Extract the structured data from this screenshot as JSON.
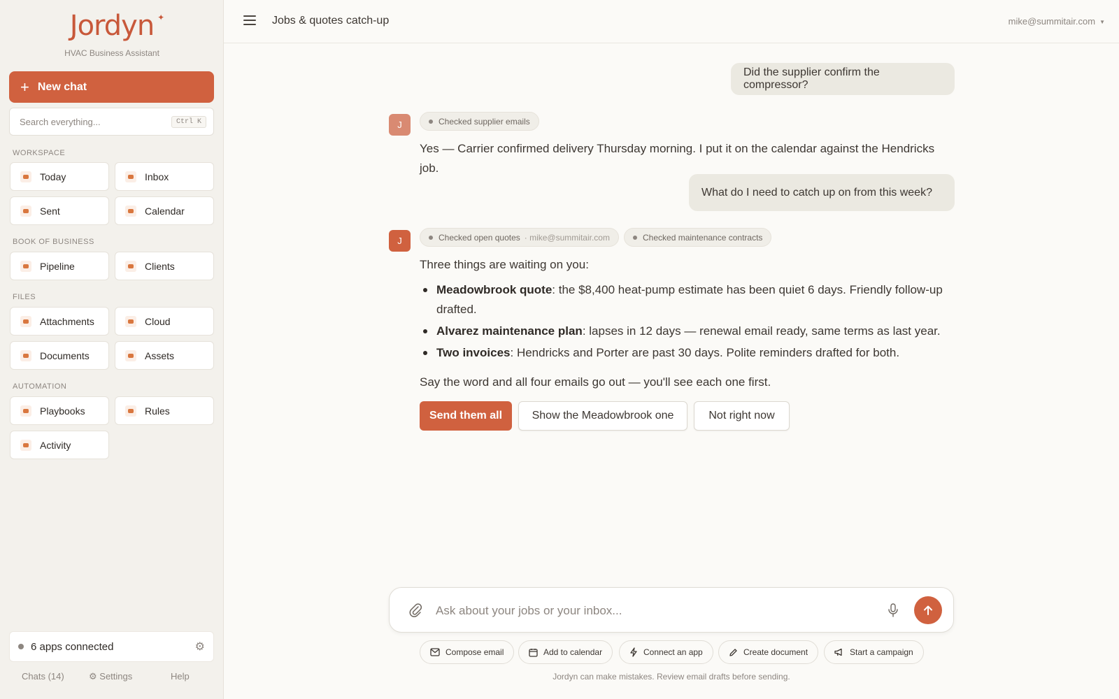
{
  "sidebar": {
    "logo": "Jordyn",
    "subtitle": "HVAC Business Assistant",
    "new_chat": "New chat",
    "search_placeholder": "Search everything...",
    "search_shortcut": "Ctrl K",
    "sections": {
      "workspace": "WORKSPACE",
      "book": "BOOK OF BUSINESS",
      "files": "FILES",
      "automation": "AUTOMATION"
    },
    "items": {
      "today": "Today",
      "inbox": "Inbox",
      "sent": "Sent",
      "calendar": "Calendar",
      "pipeline": "Pipeline",
      "clients": "Clients",
      "attachments": "Attachments",
      "cloud": "Cloud",
      "documents": "Documents",
      "assets": "Assets",
      "playbooks": "Playbooks",
      "rules": "Rules",
      "activity": "Activity"
    },
    "apps_connected": "6 apps connected",
    "footer": {
      "chats": "Chats (14)",
      "settings": "Settings",
      "help": "Help"
    }
  },
  "header": {
    "title": "Jobs & quotes catch-up",
    "account": "mike@summitair.com"
  },
  "chat": {
    "user_msg_1": "Did the supplier confirm the compressor?",
    "avatar": "J",
    "chip_supplier": "Checked supplier emails",
    "reply_1": "Yes — Carrier confirmed delivery Thursday morning. I put it on the calendar against the Hendricks job.",
    "user_msg_2": "What do I need to catch up on from this week?",
    "chip_quotes": "Checked open quotes",
    "chip_quotes_sub": "· mike@summitair.com",
    "chip_contracts": "Checked maintenance contracts",
    "intro": "Three things are waiting on you:",
    "items": [
      {
        "title": "Meadowbrook quote",
        "text": ": the $8,400 heat-pump estimate has been quiet 6 days. Friendly follow-up drafted."
      },
      {
        "title": "Alvarez maintenance plan",
        "text": ": lapses in 12 days — renewal email ready, same terms as last year."
      },
      {
        "title": "Two invoices",
        "text": ": Hendricks and Porter are past 30 days. Polite reminders drafted for both."
      }
    ],
    "outro": "Say the word and all four emails go out — you'll see each one first.",
    "buttons": {
      "send_all": "Send them all",
      "show_meadowbrook": "Show the Meadowbrook one",
      "not_now": "Not right now"
    }
  },
  "composer": {
    "placeholder": "Ask about your jobs or your inbox...",
    "actions": {
      "compose": "Compose email",
      "calendar": "Add to calendar",
      "connect": "Connect an app",
      "document": "Create document",
      "campaign": "Start a campaign"
    },
    "disclaimer": "Jordyn can make mistakes. Review email drafts before sending."
  },
  "colors": {
    "accent": "#d0613f",
    "sidebar_bg": "#f3f1ec",
    "bubble_bg": "#ebe9e1"
  }
}
